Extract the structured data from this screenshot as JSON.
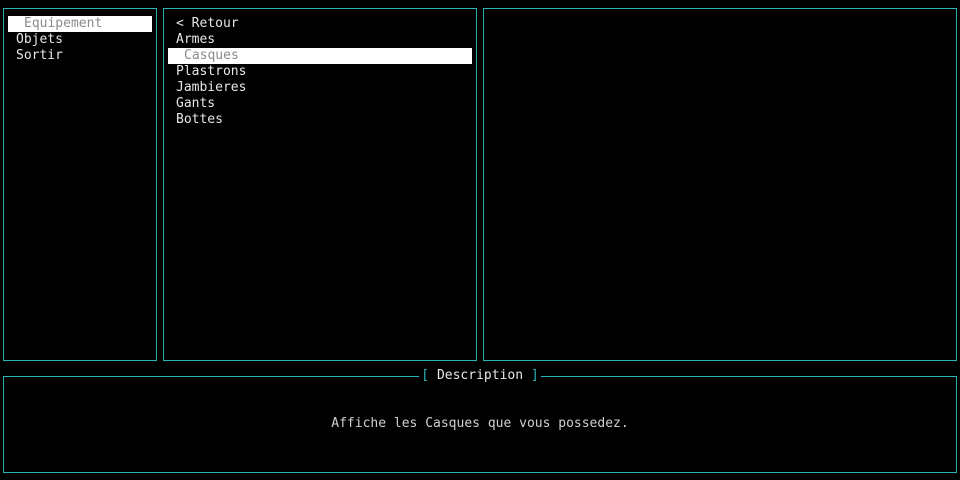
{
  "main_menu": {
    "items": [
      {
        "label": "Equipement",
        "selected": true
      },
      {
        "label": "Objets",
        "selected": false
      },
      {
        "label": "Sortir",
        "selected": false
      }
    ]
  },
  "sub_menu": {
    "items": [
      {
        "label": "< Retour",
        "selected": false
      },
      {
        "label": "Armes",
        "selected": false
      },
      {
        "label": "Casques",
        "selected": true
      },
      {
        "label": "Plastrons",
        "selected": false
      },
      {
        "label": "Jambieres",
        "selected": false
      },
      {
        "label": "Gants",
        "selected": false
      },
      {
        "label": "Bottes",
        "selected": false
      }
    ]
  },
  "description": {
    "title": "Description",
    "bracket_open": "[",
    "bracket_close": "]",
    "text": "Affiche les Casques que vous possedez."
  },
  "colors": {
    "border": "#2bb3b3",
    "background": "#000000",
    "selection_bg": "#ffffff",
    "selection_fg": "#8a8a8a"
  }
}
